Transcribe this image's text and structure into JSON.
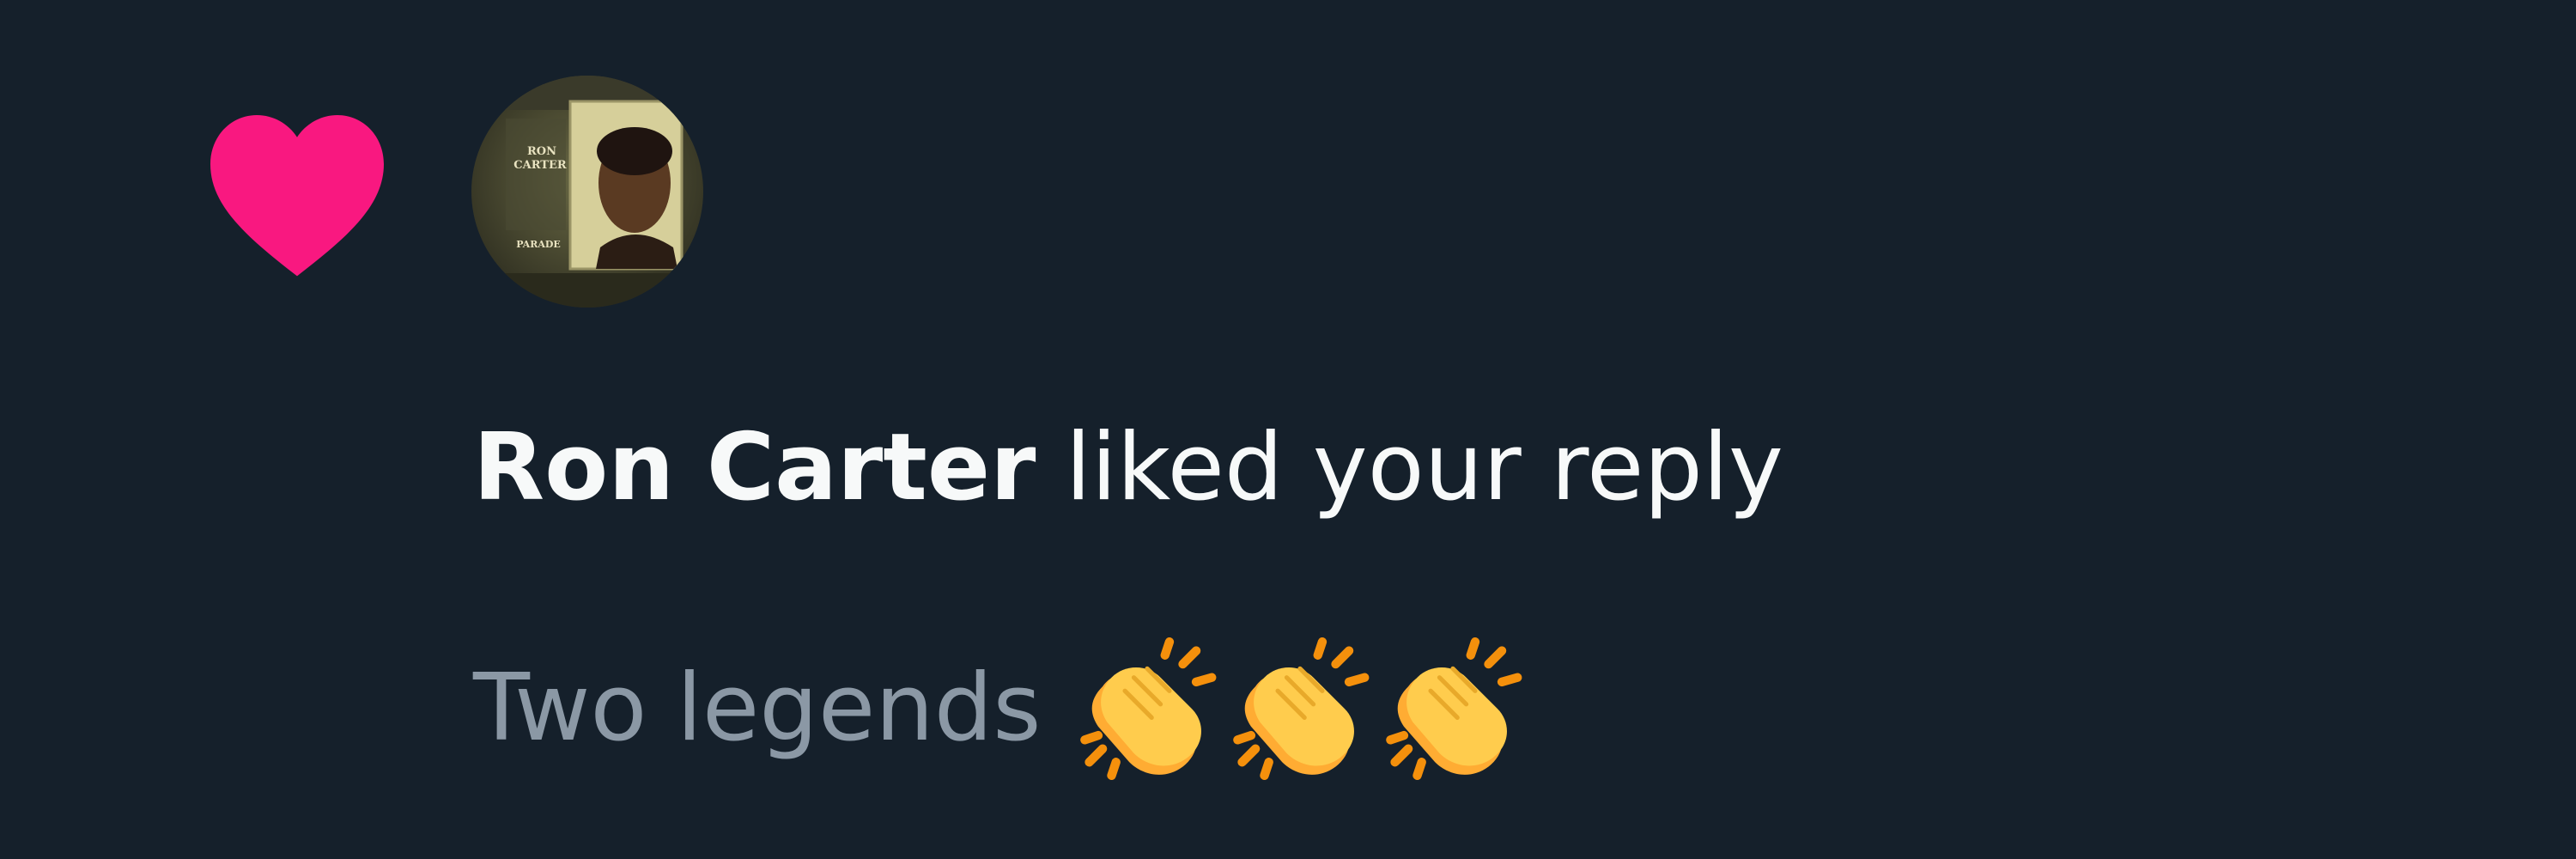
{
  "notification": {
    "type_icon": "heart-icon",
    "avatar": {
      "icon": "avatar",
      "album_text_line1": "RON",
      "album_text_line2": "CARTER",
      "album_text_line3": "PARADE"
    },
    "user_name": "Ron Carter",
    "action_text": "liked your reply",
    "reply_text": "Two legends",
    "reply_emojis": [
      "clap-icon",
      "clap-icon",
      "clap-icon"
    ]
  },
  "colors": {
    "background": "#15202b",
    "heart": "#f91880",
    "primary_text": "#f7f9f9",
    "secondary_text": "#8b98a5",
    "clap_yellow": "#ffcc4d",
    "clap_orange": "#f4900c"
  }
}
